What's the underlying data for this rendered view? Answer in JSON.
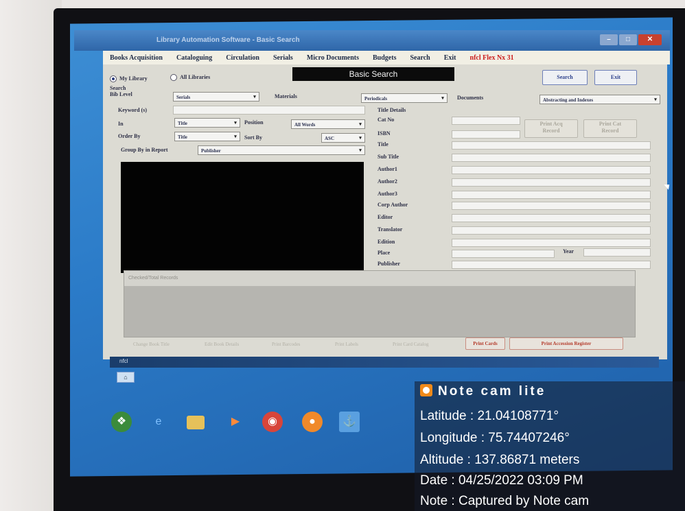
{
  "window": {
    "title": "Library Automation Software - Basic Search"
  },
  "menu": {
    "items": [
      "Books Acquisition",
      "Cataloguing",
      "Circulation",
      "Serials",
      "Micro Documents",
      "Budgets",
      "Search",
      "Exit"
    ],
    "right": "nfcl Flex Nx 31"
  },
  "search": {
    "radio_my": "My Library",
    "radio_all": "All Libraries",
    "heading": "Basic Search",
    "search_btn": "Search",
    "exit_btn": "Exit",
    "level_label": "Search\nBib Level",
    "level_value": "Serials",
    "materials_label": "Materials",
    "materials_value": "Periodicals",
    "documents_label": "Documents",
    "documents_value": "Abstracting and Indexes",
    "keyword_label": "Keyword (s)",
    "in_label": "In",
    "in_value": "Title",
    "position_label": "Position",
    "position_value": "All Words",
    "order_label": "Order By",
    "order_value": "Title",
    "sort_label": "Sort By",
    "sort_value": "ASC",
    "group_label": "Group By in Report",
    "group_value": "Publisher"
  },
  "details": {
    "header": "Title Details",
    "fields": [
      "Cat No",
      "ISBN",
      "Title",
      "Sub Title",
      "Author1",
      "Author2",
      "Author3",
      "Corp Author",
      "Editor",
      "Translator",
      "Edition",
      "Place",
      "Publisher"
    ],
    "year_label": "Year",
    "print_acq": "Print Acq\nRecord",
    "print_cat": "Print Cat\nRecord"
  },
  "grid": {
    "header": "Checked/Total Records"
  },
  "footer": {
    "buttons": [
      "Change Book Title",
      "Edit Book Details",
      "Print Barcodes",
      "Print Labels",
      "Print Card Catalog"
    ],
    "print_cards": "Print Cards",
    "print_accession": "Print Accession Register"
  },
  "statusbar": {
    "text": "nfcl"
  },
  "overlay": {
    "app": "Note cam lite",
    "latitude": "Latitude : 21.04108771°",
    "longitude": "Longitude : 75.74407246°",
    "altitude": "Altitude : 137.86871 meters",
    "date": "Date : 04/25/2022 03:09 PM",
    "note": "Note : Captured by Note cam"
  },
  "colors": {
    "accent_red": "#cc1d1d",
    "overlay_icon": "#f08a1a",
    "desktop_blue": "#2b7bc8"
  },
  "taskbar_icons": [
    "start-orb-icon",
    "ie-icon",
    "folder-icon",
    "media-player-icon",
    "chrome-icon",
    "firefox-icon",
    "network-icon"
  ]
}
